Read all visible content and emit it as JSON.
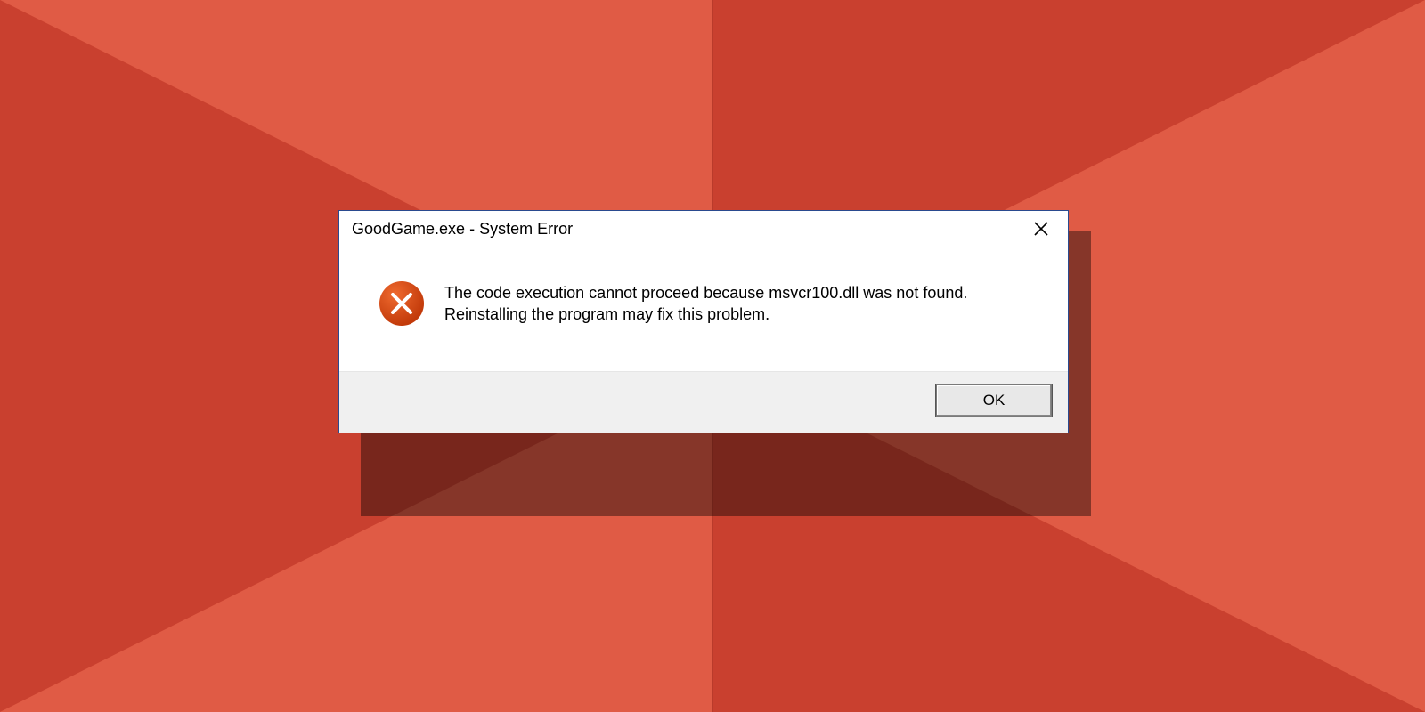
{
  "dialog": {
    "title": "GoodGame.exe - System Error",
    "message": "The code execution cannot proceed because msvcr100.dll was not found. Reinstalling the program may fix this problem.",
    "ok_label": "OK"
  },
  "icons": {
    "close": "close-icon",
    "error": "error-icon"
  },
  "colors": {
    "bg_light": "#e05b45",
    "bg_dark": "#c23f2e",
    "dialog_border": "#2a4a8f",
    "error_circle": "#d24a16"
  }
}
